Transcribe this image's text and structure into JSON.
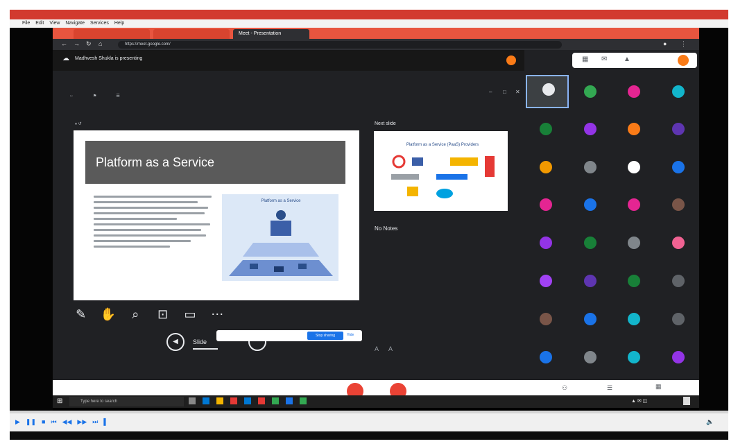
{
  "player": {
    "title": "",
    "menu": [
      "File",
      "Edit",
      "View",
      "Navigate",
      "Services",
      "Help"
    ],
    "status": ""
  },
  "browser": {
    "tabs": [
      {
        "label": "",
        "color": "#e8553f"
      },
      {
        "label": "",
        "color": "#e8553f"
      },
      {
        "label": "Meet - Presentation",
        "color": "#2e2f33"
      }
    ],
    "url": "https://meet.google.com/"
  },
  "meet": {
    "present_banner": "Madhvesh Shukla is presenting",
    "notification": "",
    "colors": {
      "accent": "#1a73e8",
      "end_call": "#ea4335",
      "banner": "#171717"
    }
  },
  "slides": {
    "current_title": "Platform as a Service",
    "illustration_title": "Platform as a Service",
    "next_label": "Next slide",
    "next_title": "Platform as a Service (PaaS) Providers",
    "notes": "No Notes",
    "slide_label": "Slide",
    "share_text": "",
    "share_button": "Stop sharing",
    "hide_button": "Hide"
  },
  "participants": [
    {
      "initial": "",
      "color": "#3c4043"
    },
    {
      "initial": "",
      "color": "#33a852"
    },
    {
      "initial": "",
      "color": "#e52592"
    },
    {
      "initial": "",
      "color": "#12b5cb"
    },
    {
      "initial": "",
      "color": "#188038"
    },
    {
      "initial": "",
      "color": "#9334e6"
    },
    {
      "initial": "",
      "color": "#fa7b17"
    },
    {
      "initial": "",
      "color": "#5e35b1"
    },
    {
      "initial": "",
      "color": "#f29900"
    },
    {
      "initial": "",
      "color": "#80868b"
    },
    {
      "initial": "",
      "color": "#ffffff"
    },
    {
      "initial": "",
      "color": "#1a73e8"
    },
    {
      "initial": "",
      "color": "#e52592"
    },
    {
      "initial": "",
      "color": "#1a73e8"
    },
    {
      "initial": "",
      "color": "#e52592"
    },
    {
      "initial": "",
      "color": "#795548"
    },
    {
      "initial": "",
      "color": "#9334e6"
    },
    {
      "initial": "",
      "color": "#188038"
    },
    {
      "initial": "",
      "color": "#80868b"
    },
    {
      "initial": "",
      "color": "#f06292"
    },
    {
      "initial": "",
      "color": "#a142f4"
    },
    {
      "initial": "",
      "color": "#5e35b1"
    },
    {
      "initial": "",
      "color": "#188038"
    },
    {
      "initial": "",
      "color": "#5f6368"
    },
    {
      "initial": "",
      "color": "#795548"
    },
    {
      "initial": "",
      "color": "#1a73e8"
    },
    {
      "initial": "",
      "color": "#12b5cb"
    },
    {
      "initial": "",
      "color": "#5f6368"
    },
    {
      "initial": "",
      "color": "#1a73e8"
    },
    {
      "initial": "",
      "color": "#80868b"
    },
    {
      "initial": "",
      "color": "#12b5cb"
    },
    {
      "initial": "",
      "color": "#9334e6"
    }
  ],
  "taskbar": {
    "search_placeholder": "Type here to search"
  }
}
